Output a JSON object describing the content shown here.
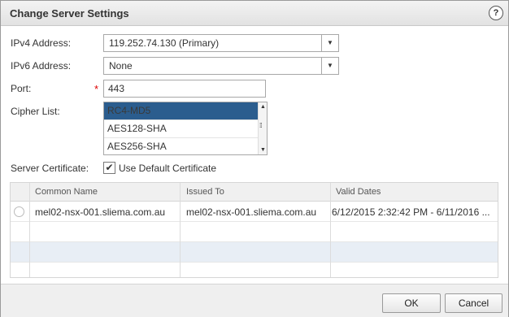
{
  "dialog": {
    "title": "Change Server Settings",
    "help_icon": "?"
  },
  "form": {
    "ipv4_label": "IPv4 Address:",
    "ipv4_value": "119.252.74.130 (Primary)",
    "ipv6_label": "IPv6 Address:",
    "ipv6_value": "None",
    "port_label": "Port:",
    "port_required": "*",
    "port_value": "443",
    "cipher_label": "Cipher List:",
    "cipher_options": [
      "RC4-MD5",
      "AES128-SHA",
      "AES256-SHA"
    ],
    "cert_label": "Server Certificate:",
    "cert_checkbox_label": "Use Default Certificate",
    "cert_checked": "✔"
  },
  "certificates": {
    "columns": [
      "Common Name",
      "Issued To",
      "Valid Dates"
    ],
    "rows": [
      {
        "common_name": "mel02-nsx-001.sliema.com.au",
        "issued_to": "mel02-nsx-001.sliema.com.au",
        "valid_dates": "6/12/2015 2:32:42 PM - 6/11/2016 ..."
      }
    ]
  },
  "footer": {
    "ok_label": "OK",
    "cancel_label": "Cancel"
  },
  "colors": {
    "selection": "#2b5d8e",
    "row_alt": "#e8eef5",
    "required": "#dd0000"
  }
}
